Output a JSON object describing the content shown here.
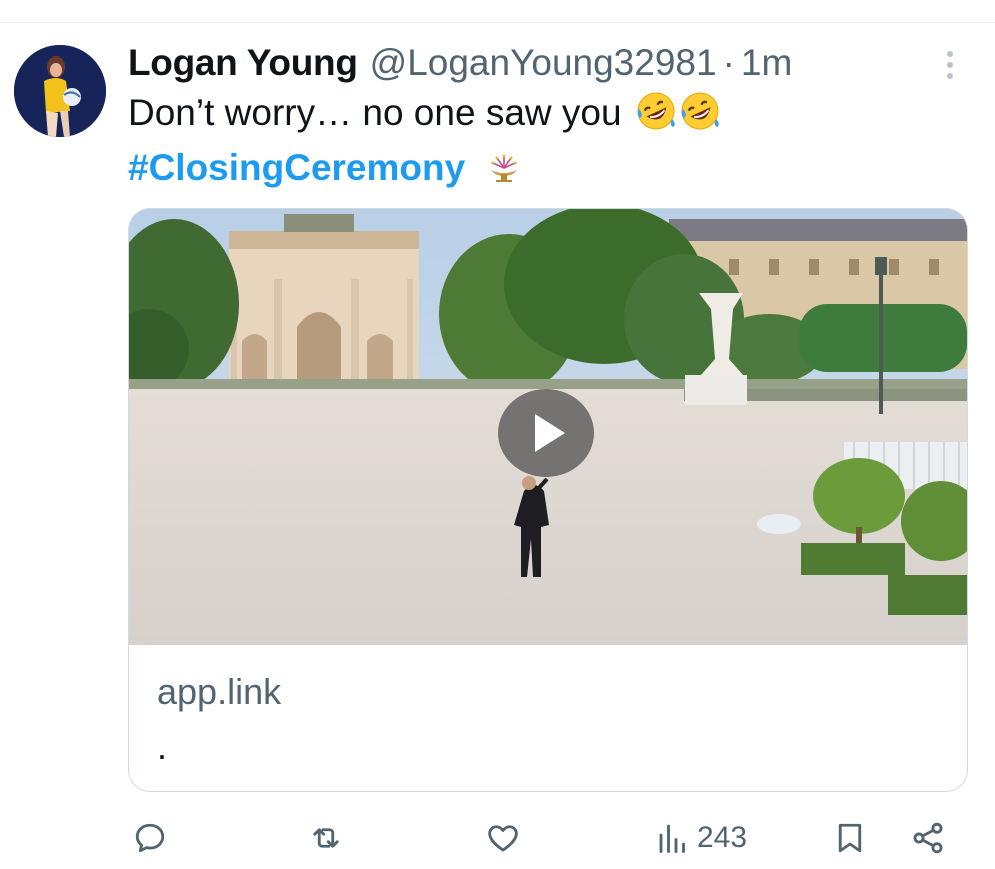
{
  "tweet": {
    "author": {
      "display_name": "Logan Young",
      "handle": "@LoganYoung32981"
    },
    "separator": "·",
    "timestamp": "1m",
    "text": "Don’t worry… no one saw you",
    "emojis": [
      "rolling-on-floor-laughing",
      "rolling-on-floor-laughing"
    ],
    "hashtag": "#ClosingCeremony",
    "hashflag_icon": "olympic-cauldron-icon"
  },
  "card": {
    "domain": "app.link",
    "description": "."
  },
  "actions": {
    "reply_icon": "reply-icon",
    "retweet_icon": "retweet-icon",
    "like_icon": "heart-icon",
    "views_icon": "views-bar-chart-icon",
    "views_count": "243",
    "bookmark_icon": "bookmark-icon",
    "share_icon": "share-icon"
  },
  "colors": {
    "link": "#1d9bf0",
    "secondary_text": "#536471",
    "icon": "#536471",
    "border": "#cfd9de"
  }
}
